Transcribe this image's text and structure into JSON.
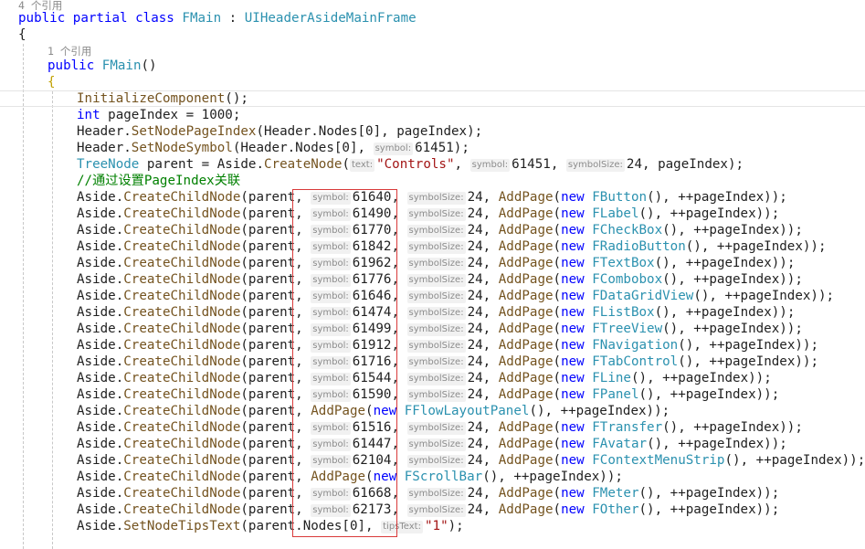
{
  "code_lens": {
    "class_refs": "4 个引用",
    "ctor_refs": "1 个引用"
  },
  "class_decl": {
    "mod1": "public",
    "mod2": "partial",
    "kw": "class",
    "name": "FMain",
    "colon": " : ",
    "base": "UIHeaderAsideMainFrame"
  },
  "open_brace": "{",
  "ctor": {
    "mod": "public",
    "name": "FMain",
    "parens": "()",
    "brace": "{"
  },
  "body": {
    "init": "InitializeComponent",
    "init_tail": "();",
    "page_index_type": "int",
    "page_index_decl": " pageIndex = 1000;",
    "set_page_index": {
      "obj": "Header.",
      "method": "SetNodePageIndex",
      "args": "(Header.Nodes[0], pageIndex);"
    },
    "set_symbol": {
      "obj": "Header.",
      "method": "SetNodeSymbol",
      "args_pre": "(Header.Nodes[0], ",
      "hint": "symbol:",
      "value": "61451",
      "tail": ");"
    },
    "tree_node": {
      "type": "TreeNode",
      "decl": " parent = Aside.",
      "method": "CreateNode",
      "hint_text": "text:",
      "text": "\"Controls\"",
      "hint_symbol": "symbol:",
      "symbol": "61451",
      "hint_size": "symbolSize:",
      "size": "24",
      "tail": ", pageIndex);"
    },
    "comment": "//通过设置PageIndex关联"
  },
  "child_nodes": [
    {
      "symbol": "61640",
      "size": "24",
      "page": "FButton"
    },
    {
      "symbol": "61490",
      "size": "24",
      "page": "FLabel"
    },
    {
      "symbol": "61770",
      "size": "24",
      "page": "FCheckBox"
    },
    {
      "symbol": "61842",
      "size": "24",
      "page": "FRadioButton"
    },
    {
      "symbol": "61962",
      "size": "24",
      "page": "FTextBox"
    },
    {
      "symbol": "61776",
      "size": "24",
      "page": "FCombobox"
    },
    {
      "symbol": "61646",
      "size": "24",
      "page": "FDataGridView"
    },
    {
      "symbol": "61474",
      "size": "24",
      "page": "FListBox"
    },
    {
      "symbol": "61499",
      "size": "24",
      "page": "FTreeView"
    },
    {
      "symbol": "61912",
      "size": "24",
      "page": "FNavigation"
    },
    {
      "symbol": "61716",
      "size": "24",
      "page": "FTabControl"
    },
    {
      "symbol": "61544",
      "size": "24",
      "page": "FLine"
    },
    {
      "symbol": "61590",
      "size": "24",
      "page": "FPanel"
    },
    {
      "symbol": "",
      "size": "",
      "page": "FFlowLayoutPanel"
    },
    {
      "symbol": "61516",
      "size": "24",
      "page": "FTransfer"
    },
    {
      "symbol": "61447",
      "size": "24",
      "page": "FAvatar"
    },
    {
      "symbol": "62104",
      "size": "24",
      "page": "FContextMenuStrip"
    },
    {
      "symbol": "",
      "size": "",
      "page": "FScrollBar"
    },
    {
      "symbol": "61668",
      "size": "24",
      "page": "FMeter"
    },
    {
      "symbol": "62173",
      "size": "24",
      "page": "FOther"
    }
  ],
  "child_tokens": {
    "obj": "Aside.",
    "method": "CreateChildNode",
    "open": "(parent, ",
    "hint_symbol": "symbol:",
    "hint_size": "symbolSize:",
    "comma": ", ",
    "addpage": "AddPage",
    "new_kw": "new",
    "ctor_tail": "(), ++pageIndex));",
    "open_paren": "("
  },
  "tips": {
    "obj": "Aside.",
    "method": "SetNodeTipsText",
    "pre": "(parent.Nodes[0], ",
    "hint": "tipsText:",
    "value": "\"1\"",
    "tail": ");"
  },
  "colors": {
    "keyword": "#0000ff",
    "type": "#2b91af",
    "method": "#74531f",
    "string": "#a31515",
    "comment": "#008000",
    "highlight_box": "#d93a3a"
  }
}
